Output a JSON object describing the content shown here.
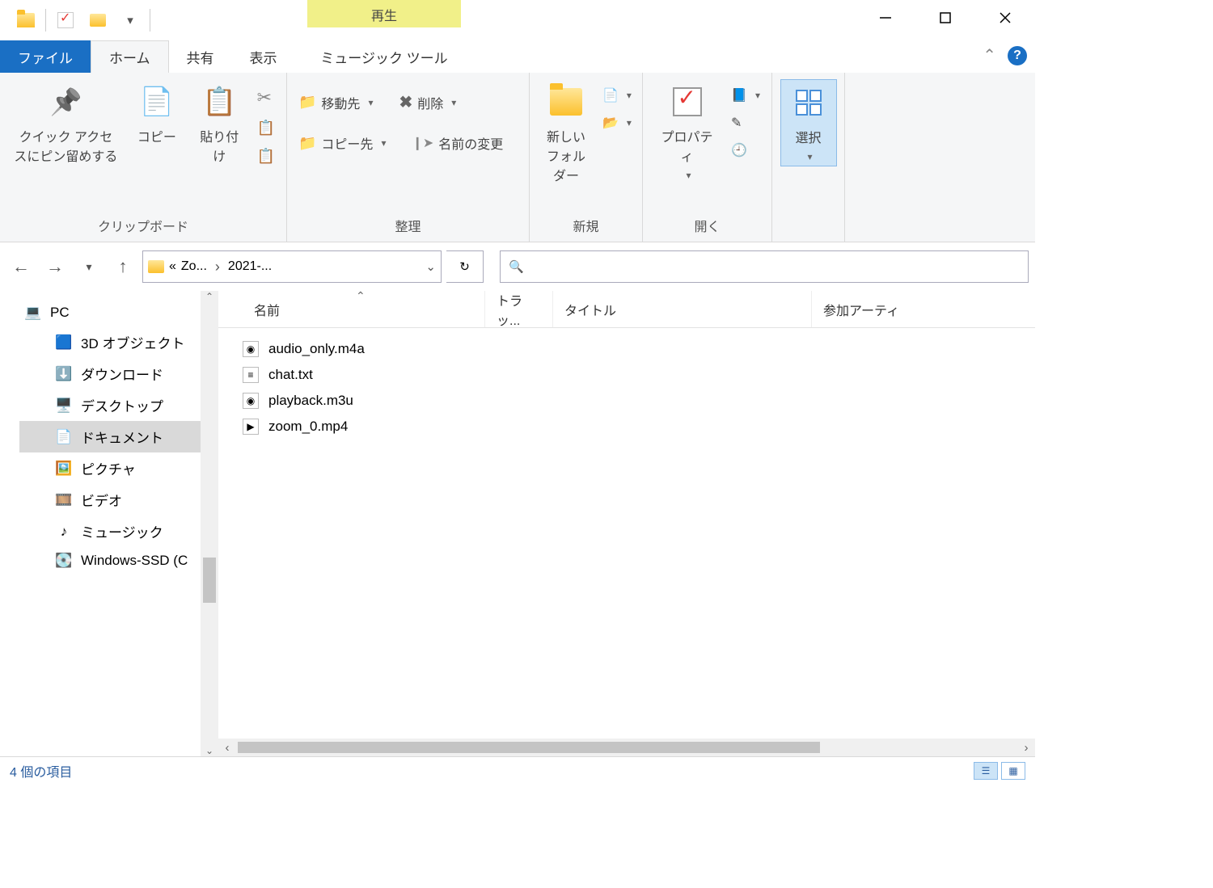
{
  "titlebar": {
    "contextual_tab_group": "再生"
  },
  "tabs": {
    "file": "ファイル",
    "home": "ホーム",
    "share": "共有",
    "view": "表示",
    "music_tools": "ミュージック ツール"
  },
  "ribbon": {
    "clipboard": {
      "pin": "クイック アクセスにピン留めする",
      "copy": "コピー",
      "paste": "貼り付け",
      "label": "クリップボード"
    },
    "organize": {
      "move_to": "移動先",
      "copy_to": "コピー先",
      "delete": "削除",
      "rename": "名前の変更",
      "label": "整理"
    },
    "new": {
      "new_folder": "新しいフォルダー",
      "label": "新規"
    },
    "open": {
      "properties": "プロパティ",
      "label": "開く"
    },
    "select": {
      "select": "選択",
      "label": ""
    }
  },
  "address": {
    "crumb1": "Zo...",
    "crumb2": "2021-...",
    "prefix": "«"
  },
  "columns": {
    "name": "名前",
    "track": "トラッ...",
    "title": "タイトル",
    "artist": "参加アーティ"
  },
  "navpane": {
    "pc": "PC",
    "items": [
      {
        "icon": "3d",
        "label": "3D オブジェクト"
      },
      {
        "icon": "dl",
        "label": "ダウンロード"
      },
      {
        "icon": "desk",
        "label": "デスクトップ"
      },
      {
        "icon": "doc",
        "label": "ドキュメント",
        "selected": true
      },
      {
        "icon": "pic",
        "label": "ピクチャ"
      },
      {
        "icon": "vid",
        "label": "ビデオ"
      },
      {
        "icon": "mus",
        "label": "ミュージック"
      },
      {
        "icon": "drv",
        "label": "Windows-SSD (C"
      }
    ]
  },
  "files": [
    {
      "icon": "m4a",
      "name": "audio_only.m4a"
    },
    {
      "icon": "txt",
      "name": "chat.txt"
    },
    {
      "icon": "m3u",
      "name": "playback.m3u"
    },
    {
      "icon": "mp4",
      "name": "zoom_0.mp4"
    }
  ],
  "status": {
    "text": "4 個の項目"
  }
}
